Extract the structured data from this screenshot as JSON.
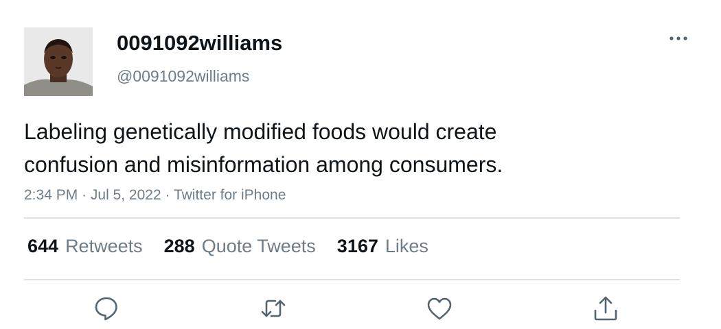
{
  "user": {
    "display_name": "0091092williams",
    "handle": "@0091092williams",
    "avatar_icon": "profile-photo"
  },
  "tweet": {
    "text": "Labeling genetically modified foods would create\nconfusion and misinformation among consumers.",
    "time": "2:34 PM",
    "separator": "·",
    "date": "Jul 5, 2022",
    "source": "Twitter for iPhone"
  },
  "stats": {
    "retweets": {
      "count": "644",
      "label": "Retweets"
    },
    "quote_tweets": {
      "count": "288",
      "label": "Quote Tweets"
    },
    "likes": {
      "count": "3167",
      "label": "Likes"
    }
  },
  "actions": {
    "reply_icon": "reply-icon",
    "retweet_icon": "retweet-icon",
    "like_icon": "like-icon",
    "share_icon": "share-icon",
    "more_icon": "more-icon"
  },
  "colors": {
    "primary_text": "#0f1419",
    "secondary_text": "#6e7c87",
    "divider": "#dde1e4",
    "icon": "#536471"
  }
}
